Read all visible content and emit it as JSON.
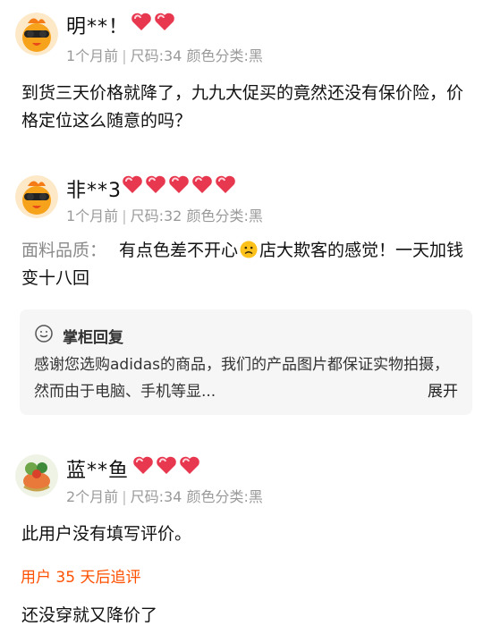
{
  "reviews": [
    {
      "username": "明**！",
      "hearts": 2,
      "meta": {
        "time": "1个月前",
        "size": "尺码:34",
        "color": "颜色分类:黑"
      },
      "content": "到货三天价格就降了，九九大促买的竟然还没有保价险，价格定位这么随意的吗？",
      "avatar_icon": "cartoon-bird-sunglasses-icon"
    },
    {
      "username": "非**3",
      "hearts": 5,
      "meta": {
        "time": "1个月前",
        "size": "尺码:32",
        "color": "颜色分类:黑"
      },
      "content_label": "面料品质：",
      "content_part1": "有点色差不开心",
      "content_part2": "店大欺客的感觉！一天加钱变十八回",
      "emoji_icon": "sad-face-emoji-icon",
      "avatar_icon": "cartoon-bird-sunglasses-icon",
      "seller_reply": {
        "title": "掌柜回复",
        "text": "感谢您选购adidas的商品，我们的产品图片都保证实物拍摄，然而由于电脑、手机等显...",
        "expand_label": "展开"
      }
    },
    {
      "username": "蓝**鱼",
      "hearts": 3,
      "meta": {
        "time": "2个月前",
        "size": "尺码:34",
        "color": "颜色分类:黑"
      },
      "content": "此用户没有填写评价。",
      "avatar_icon": "photo-avatar-icon",
      "followup": {
        "label": "用户 35 天后追评",
        "content": "还没穿就又降价了"
      }
    }
  ],
  "colors": {
    "heart": "#e8384f",
    "followup_accent": "#ff5000",
    "meta_text": "#9a9a9a",
    "reply_bg": "#f6f6f6"
  }
}
